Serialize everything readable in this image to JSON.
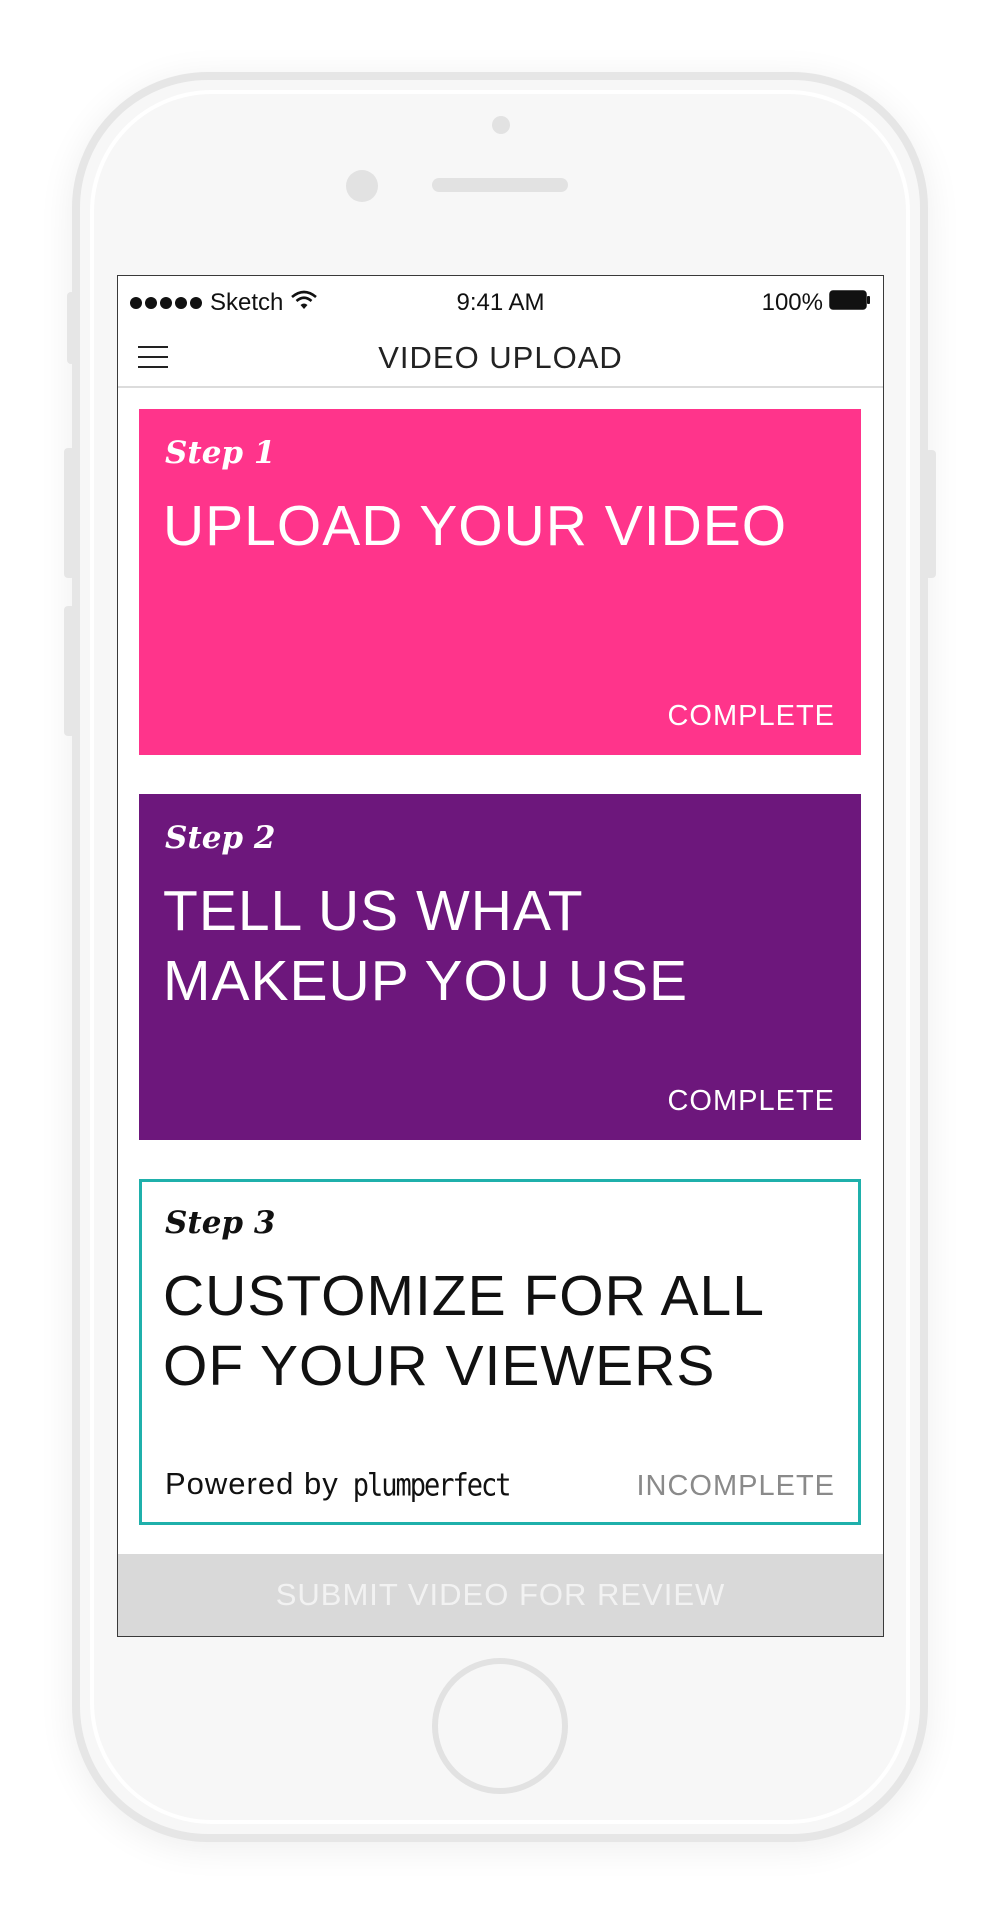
{
  "status_bar": {
    "carrier": "Sketch",
    "time": "9:41 AM",
    "battery": "100%"
  },
  "nav": {
    "title": "VIDEO UPLOAD",
    "menu_icon": "hamburger-menu-icon"
  },
  "steps": [
    {
      "label": "Step 1",
      "title": "UPLOAD YOUR VIDEO",
      "status": "COMPLETE",
      "color": "#ff348b"
    },
    {
      "label": "Step 2",
      "title": "TELL US WHAT\nMAKEUP YOU USE",
      "status": "COMPLETE",
      "color": "#6d177c"
    },
    {
      "label": "Step 3",
      "title": "CUSTOMIZE FOR ALL\nOF YOUR VIEWERS",
      "status": "INCOMPLETE",
      "color": "#1fb0ab"
    }
  ],
  "powered_by": {
    "text": "Powered by",
    "brand": "plumperfect"
  },
  "submit": {
    "label": "SUBMIT VIDEO FOR REVIEW"
  }
}
